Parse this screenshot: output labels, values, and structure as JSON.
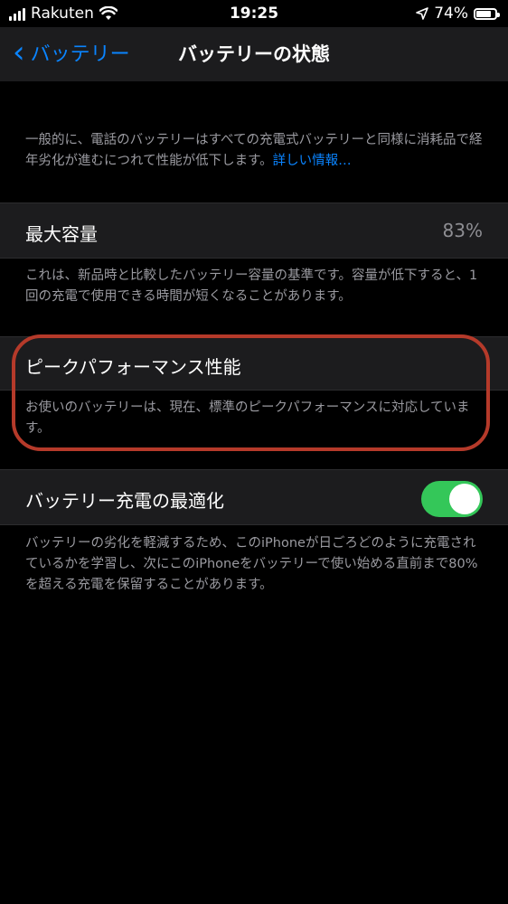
{
  "status_bar": {
    "carrier": "Rakuten",
    "time": "19:25",
    "battery_percent": "74%",
    "battery_level": 0.74
  },
  "nav": {
    "back_label": "バッテリー",
    "title": "バッテリーの状態"
  },
  "intro": {
    "text": "一般的に、電話のバッテリーはすべての充電式バッテリーと同様に消耗品で経年劣化が進むにつれて性能が低下します。",
    "link": "詳しい情報…"
  },
  "max_capacity": {
    "label": "最大容量",
    "value": "83%",
    "footer": "これは、新品時と比較したバッテリー容量の基準です。容量が低下すると、1回の充電で使用できる時間が短くなることがあります。"
  },
  "peak_performance": {
    "label": "ピークパフォーマンス性能",
    "description": "お使いのバッテリーは、現在、標準のピークパフォーマンスに対応しています。"
  },
  "optimized_charging": {
    "label": "バッテリー充電の最適化",
    "enabled": true,
    "footer": "バッテリーの劣化を軽減するため、このiPhoneが日ごろどのように充電されているかを学習し、次にこのiPhoneをバッテリーで使い始める直前まで80%を超える充電を保留することがあります。"
  },
  "colors": {
    "accent": "#0a84ff",
    "toggle_on": "#34c759",
    "highlight": "#b53a2a",
    "cell_bg": "#1c1c1e"
  }
}
